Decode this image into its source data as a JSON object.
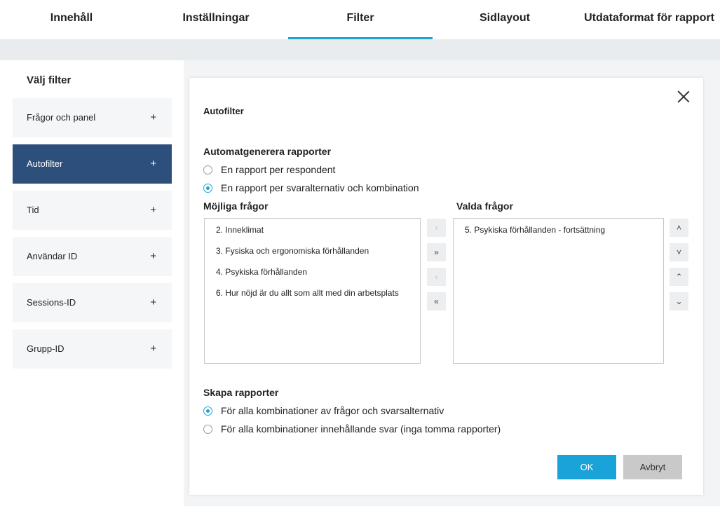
{
  "tabs": [
    {
      "label": "Innehåll"
    },
    {
      "label": "Inställningar"
    },
    {
      "label": "Filter"
    },
    {
      "label": "Sidlayout"
    },
    {
      "label": "Utdataformat för rapport"
    }
  ],
  "sidebar": {
    "title": "Välj filter",
    "items": [
      {
        "label": "Frågor och panel",
        "icon": "+"
      },
      {
        "label": "Autofilter",
        "icon": "+"
      },
      {
        "label": "Tid",
        "icon": "+"
      },
      {
        "label": "Användar ID",
        "icon": "+"
      },
      {
        "label": "Sessions-ID",
        "icon": "+"
      },
      {
        "label": "Grupp-ID",
        "icon": "+"
      }
    ]
  },
  "panel": {
    "title": "Autofilter",
    "auto_generate": {
      "title": "Automatgenerera rapporter",
      "options": [
        {
          "label": "En rapport per respondent",
          "selected": false
        },
        {
          "label": "En rapport per svaralternativ och kombination",
          "selected": true
        }
      ]
    },
    "possible_questions": {
      "title": "Möjliga frågor",
      "items": [
        "2. Inneklimat",
        "3. Fysiska och ergonomiska förhållanden",
        "4. Psykiska förhållanden",
        "6. Hur nöjd är du allt som allt med din arbetsplats"
      ]
    },
    "selected_questions": {
      "title": "Valda frågor",
      "items": [
        "5. Psykiska förhållanden - fortsättning"
      ]
    },
    "transfer_buttons": {
      "move_right": "›",
      "move_all_right": "»",
      "move_left": "‹",
      "move_all_left": "«"
    },
    "order_buttons": {
      "up": "˄",
      "down": "˅",
      "top": "⌃",
      "bottom": "⌄"
    },
    "create_reports": {
      "title": "Skapa rapporter",
      "options": [
        {
          "label": "För alla kombinationer av frågor och svarsalternativ",
          "selected": true
        },
        {
          "label": "För alla kombinationer innehållande svar (inga tomma rapporter)",
          "selected": false
        }
      ]
    },
    "ok_label": "OK",
    "cancel_label": "Avbryt"
  },
  "colors": {
    "accent": "#1aa3d9",
    "sidebar_active": "#2c4f7c",
    "cancel": "#c9c9c9"
  }
}
